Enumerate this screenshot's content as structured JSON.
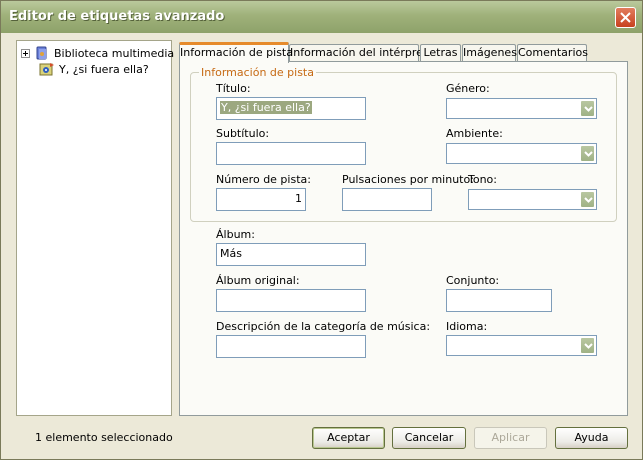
{
  "window": {
    "title": "Editor de etiquetas avanzado"
  },
  "tree": {
    "items": [
      {
        "label": "Biblioteca multimedia",
        "icon": "library-icon"
      },
      {
        "label": "Y, ¿si fuera ella?",
        "icon": "audio-track-icon"
      }
    ]
  },
  "tabs": [
    {
      "label": "Información de pista",
      "active": true
    },
    {
      "label": "Información del intérprete",
      "active": false
    },
    {
      "label": "Letras",
      "active": false
    },
    {
      "label": "Imágenes",
      "active": false
    },
    {
      "label": "Comentarios",
      "active": false
    }
  ],
  "group": {
    "title": "Información de pista"
  },
  "fields": {
    "titulo": {
      "label": "Título:",
      "value": "Y, ¿si fuera ella?"
    },
    "genero": {
      "label": "Género:",
      "value": ""
    },
    "subtitulo": {
      "label": "Subtítulo:",
      "value": ""
    },
    "ambiente": {
      "label": "Ambiente:",
      "value": ""
    },
    "numero_pista": {
      "label": "Número de pista:",
      "value": "1"
    },
    "pulsaciones": {
      "label": "Pulsaciones por minuto:",
      "value": ""
    },
    "tono": {
      "label": "Tono:",
      "value": ""
    },
    "album": {
      "label": "Álbum:",
      "value": "Más"
    },
    "album_original": {
      "label": "Álbum original:",
      "value": ""
    },
    "conjunto": {
      "label": "Conjunto:",
      "value": ""
    },
    "descripcion": {
      "label": "Descripción de la categoría de música:",
      "value": ""
    },
    "idioma": {
      "label": "Idioma:",
      "value": ""
    }
  },
  "status": {
    "text": "1 elemento seleccionado"
  },
  "buttons": {
    "aceptar": "Aceptar",
    "cancelar": "Cancelar",
    "aplicar": "Aplicar",
    "ayuda": "Ayuda"
  },
  "colors": {
    "accent": "#e68b2c",
    "titlebar": "#9fb17a",
    "group_title": "#c66a14",
    "close": "#c8411f"
  }
}
